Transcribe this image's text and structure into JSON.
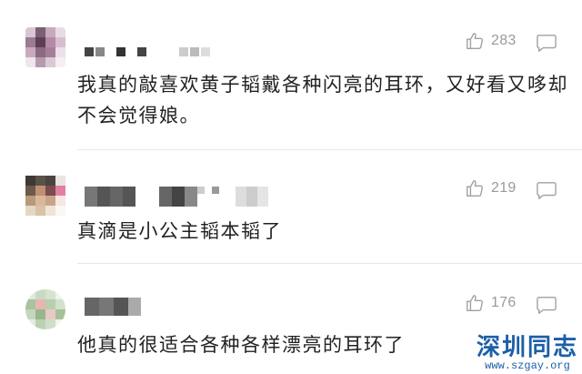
{
  "comments": [
    {
      "text": "我真的敲喜欢黄子韬戴各种闪亮的耳环，又好看又哆却不会觉得娘。",
      "likes": "283"
    },
    {
      "text": "真滴是小公主韬本韬了",
      "likes": "219"
    },
    {
      "text": "他真的很适合各种各样漂亮的耳环了",
      "likes": "176"
    }
  ],
  "watermark": {
    "title": "深圳同志",
    "url": "www.szgay.org"
  },
  "colors": {
    "text": "#222222",
    "meta": "#9a9a9a",
    "divider": "#e8e8e8",
    "watermark": "#1c5fa8"
  },
  "icons": {
    "like": "thumbs-up-icon",
    "reply": "comment-bubble-icon"
  }
}
